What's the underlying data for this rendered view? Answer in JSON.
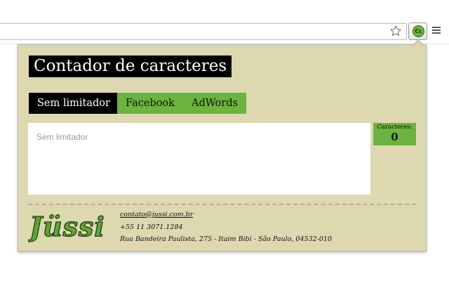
{
  "browser": {
    "bookmark_icon": "star-icon",
    "extension_icon_text": "Cc",
    "menu_icon": "hamburger-menu-icon"
  },
  "popup": {
    "title": "Contador de caracteres",
    "tabs": [
      {
        "label": "Sem limitador",
        "active": true
      },
      {
        "label": "Facebook",
        "active": false
      },
      {
        "label": "AdWords",
        "active": false
      }
    ],
    "textarea": {
      "placeholder": "Sem limitador",
      "value": ""
    },
    "counter": {
      "label": "Caracteres:",
      "value": "0"
    },
    "footer": {
      "logo_text": "Jüssi",
      "email": "contato@jussi.com.br",
      "phone": "+55 11 3071.1284",
      "address": "Rua Bandeira Paulista, 275 - Itaim Bibi - São Paulo, 04532-010"
    }
  },
  "colors": {
    "panel_bg": "#ddd8b0",
    "accent_green": "#6cb33f",
    "active_tab": "#000000"
  }
}
